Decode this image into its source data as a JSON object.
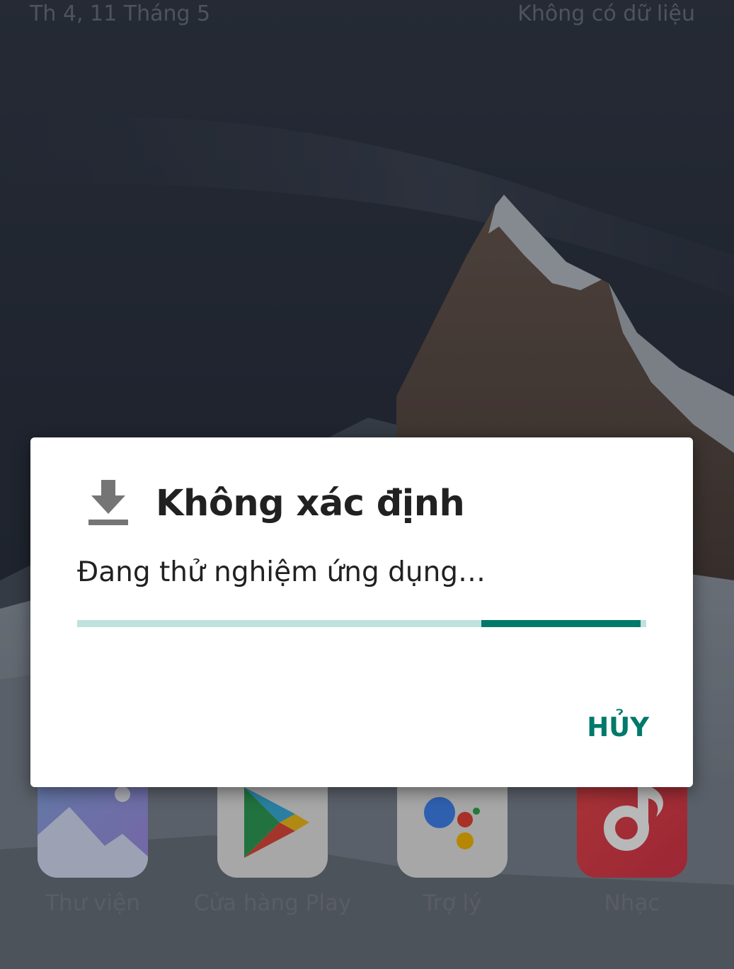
{
  "status_bar": {
    "date": "Th 4, 11 Tháng 5",
    "data_status": "Không có dữ liệu"
  },
  "dock": {
    "apps": [
      {
        "label": "Thư viện",
        "icon": "gallery-icon"
      },
      {
        "label": "Cửa hàng Play",
        "icon": "play-store-icon"
      },
      {
        "label": "Trợ lý",
        "icon": "assistant-icon"
      },
      {
        "label": "Nhạc",
        "icon": "music-icon"
      }
    ]
  },
  "dialog": {
    "icon": "download-icon",
    "title": "Không xác định",
    "message": "Đang thử nghiệm ứng dụng…",
    "progress": {
      "indeterminate": true,
      "segment_start_fraction": 0.71,
      "segment_end_fraction": 0.99
    },
    "cancel_label": "HỦY"
  },
  "colors": {
    "accent": "#00796b",
    "progress_track": "#bfe2df",
    "dialog_bg": "#ffffff",
    "title_text": "#212121"
  }
}
